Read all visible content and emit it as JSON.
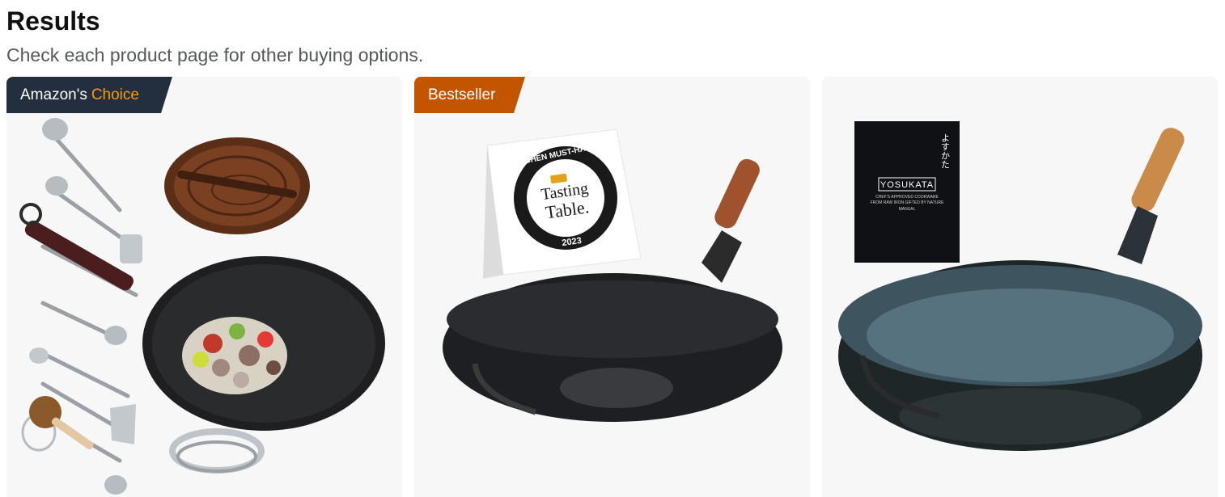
{
  "header": {
    "title": "Results",
    "subtitle": "Check each product page for other buying options."
  },
  "cards": [
    {
      "badge": {
        "prefix": "Amazon's",
        "accent": "Choice",
        "color": "#232f3e",
        "accent_color": "#ff9900"
      },
      "image_desc": "carbon-steel-wok-set-with-lid-utensils-ring"
    },
    {
      "badge": {
        "label": "Bestseller",
        "color": "#c45500"
      },
      "image_desc": "carbon-steel-wok-with-wood-handle",
      "sign": {
        "line1": "KITCHEN MUST-HAVES",
        "line2": "Tasting",
        "line3": "Table.",
        "year": "2023"
      }
    },
    {
      "image_desc": "hand-hammered-carbon-steel-wok",
      "manual": {
        "brand": "YOSUKATA",
        "jp_text": "よすかた",
        "line1": "CHEF'S APPROVED COOKWARE",
        "line2": "FROM RAW IRON GIFTED BY NATURE",
        "label": "MANUAL"
      }
    }
  ]
}
